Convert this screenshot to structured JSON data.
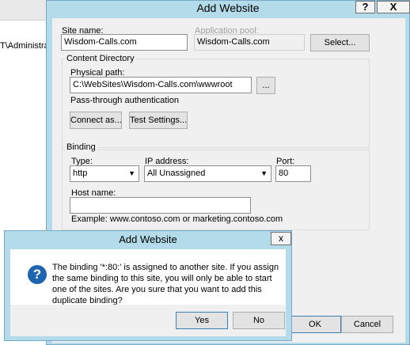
{
  "background_window": {
    "text": "T\\Administrato"
  },
  "dialog": {
    "title": "Add Website",
    "help_label": "?",
    "close_label": "X",
    "site_name_label": "Site name:",
    "site_name_value": "Wisdom-Calls.com",
    "app_pool_label": "Application pool:",
    "app_pool_value": "Wisdom-Calls.com",
    "select_button": "Select...",
    "content_directory": {
      "title": "Content Directory",
      "physical_path_label": "Physical path:",
      "physical_path_value": "C:\\WebSites\\Wisdom-Calls.com\\wwwroot",
      "browse_button": "...",
      "passthrough_label": "Pass-through authentication",
      "connect_as_button": "Connect as...",
      "test_settings_button": "Test Settings..."
    },
    "binding": {
      "title": "Binding",
      "type_label": "Type:",
      "type_value": "http",
      "ip_label": "IP address:",
      "ip_value": "All Unassigned",
      "port_label": "Port:",
      "port_value": "80",
      "host_label": "Host name:",
      "host_value": "",
      "example_text": "Example: www.contoso.com or marketing.contoso.com"
    },
    "ok_button": "OK",
    "cancel_button": "Cancel"
  },
  "message_box": {
    "title": "Add Website",
    "close_label": "x",
    "icon": "question-icon",
    "icon_glyph": "?",
    "text": "The binding '*:80:' is assigned to another site. If you assign the same binding to this site, you will only be able to start one of the sites. Are you sure that you want to add this duplicate binding?",
    "yes_button": "Yes",
    "no_button": "No"
  },
  "colors": {
    "frame": "#b4dbea",
    "dialog_face": "#f0f0f0",
    "icon_blue": "#1e64b0"
  }
}
